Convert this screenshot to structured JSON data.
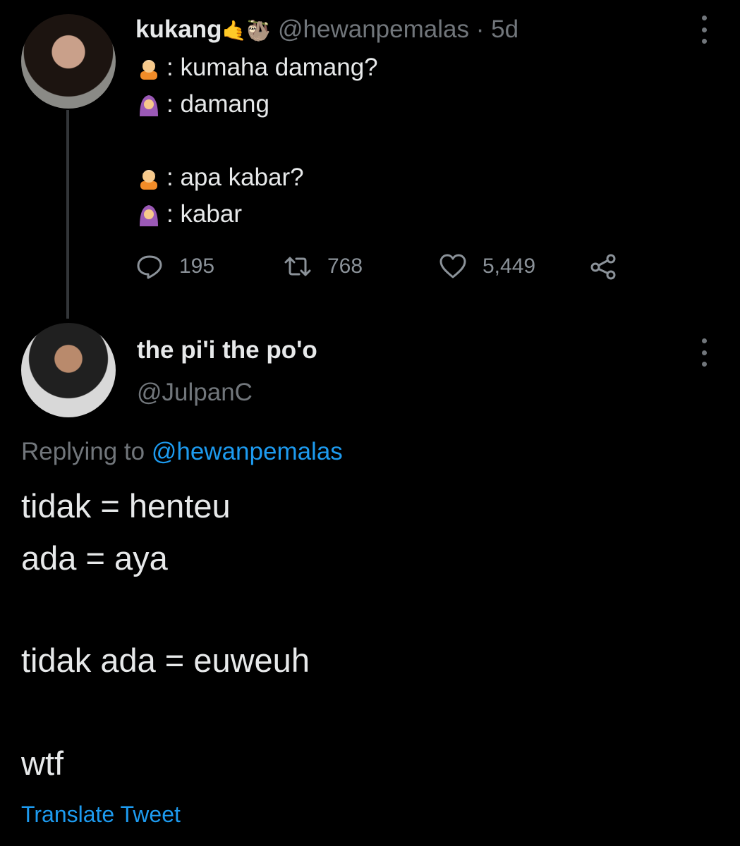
{
  "tweet1": {
    "author_name": "kukang",
    "name_emoji": "🤙🦥",
    "handle": "@hewanpemalas",
    "separator": "·",
    "time": "5d",
    "lines": [
      {
        "icon": "person-white-hair-emoji",
        "text": ": kumaha damang?"
      },
      {
        "icon": "woman-headscarf-emoji",
        "text": ": damang"
      },
      {
        "icon": "person-white-hair-emoji",
        "text": ": apa kabar?"
      },
      {
        "icon": "woman-headscarf-emoji",
        "text": ": kabar"
      }
    ],
    "stats": {
      "replies": "195",
      "retweets": "768",
      "likes": "5,449"
    }
  },
  "tweet2": {
    "author_name": "the pi'i the po'o",
    "handle": "@JulpanC",
    "replying_prefix": "Replying to",
    "replying_to": "@hewanpemalas",
    "body": [
      "tidak = henteu",
      "ada = aya",
      "tidak ada = euweuh",
      "wtf"
    ],
    "translate_label": "Translate Tweet"
  },
  "colors": {
    "background": "#000000",
    "text": "#e7e9ea",
    "muted": "#71767b",
    "link": "#1d9bf0"
  }
}
